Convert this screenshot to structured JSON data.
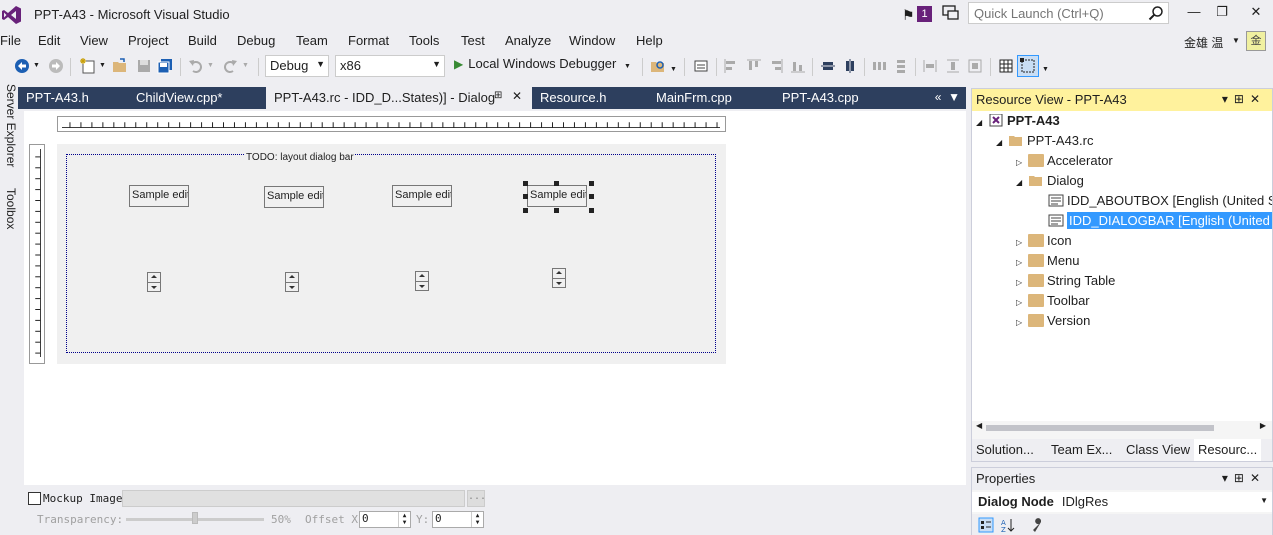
{
  "window": {
    "title": "PPT-A43 - Microsoft Visual Studio",
    "notification_count": "1",
    "quick_launch_placeholder": "Quick Launch (Ctrl+Q)"
  },
  "menu": {
    "items": [
      "File",
      "Edit",
      "View",
      "Project",
      "Build",
      "Debug",
      "Team",
      "Format",
      "Tools",
      "Test",
      "Analyze",
      "Window",
      "Help"
    ],
    "user_name": "金雄 温",
    "avatar_glyph": "金"
  },
  "toolbar": {
    "config": "Debug",
    "platform": "x86",
    "debugger": "Local Windows Debugger"
  },
  "side_tabs": [
    "Server Explorer",
    "Toolbox"
  ],
  "doc_tabs": [
    {
      "label": "PPT-A43.h",
      "active": false
    },
    {
      "label": "ChildView.cpp*",
      "active": false
    },
    {
      "label": "PPT-A43.rc - IDD_D...States)] - Dialog",
      "active": true
    },
    {
      "label": "Resource.h",
      "active": false
    },
    {
      "label": "MainFrm.cpp",
      "active": false
    },
    {
      "label": "PPT-A43.cpp",
      "active": false
    }
  ],
  "dialog": {
    "todo_label": "TODO: layout dialog bar",
    "edit_controls": [
      "Sample edit",
      "Sample edit",
      "Sample edit",
      "Sample edit"
    ]
  },
  "mockup": {
    "label": "Mockup Image:",
    "browse": "...",
    "transparency_label": "Transparency:",
    "transparency_value": "50%",
    "offset_x_label": "Offset X:",
    "offset_x": "0",
    "y_label": "Y:",
    "offset_y": "0"
  },
  "resource_view": {
    "title": "Resource View - PPT-A43",
    "tree": {
      "root": "PPT-A43",
      "rc": "PPT-A43.rc",
      "folders": [
        "Accelerator",
        "Dialog",
        "Icon",
        "Menu",
        "String Table",
        "Toolbar",
        "Version"
      ],
      "dialogs": [
        "IDD_ABOUTBOX [English (United S",
        "IDD_DIALOGBAR [English (United"
      ]
    },
    "tabs": [
      "Solution...",
      "Team Ex...",
      "Class View",
      "Resourc..."
    ]
  },
  "properties": {
    "title": "Properties",
    "object_name": "Dialog Node",
    "object_type": "IDlgRes"
  }
}
